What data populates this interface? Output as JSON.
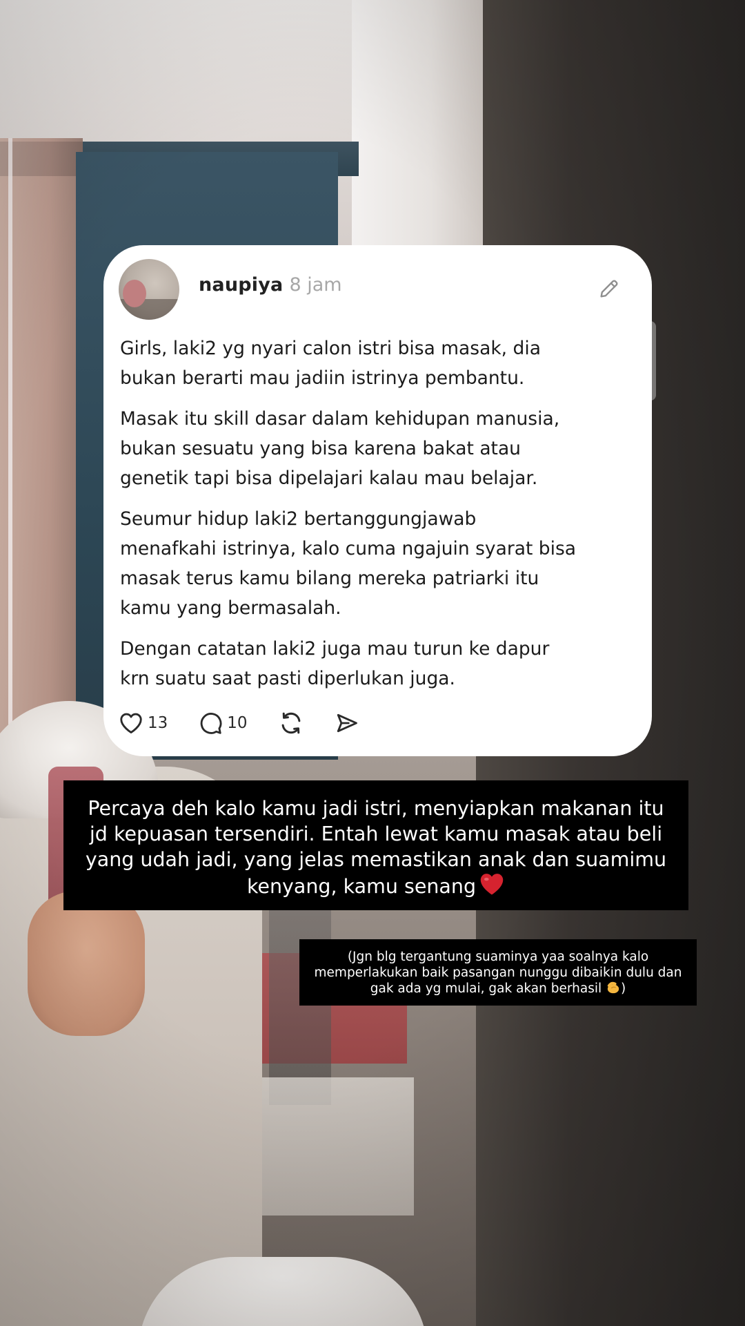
{
  "post": {
    "username": "naupiya",
    "time": "8 jam",
    "paragraphs": [
      "Girls, laki2 yg nyari calon istri bisa masak, dia\nbukan berarti mau jadiin istrinya pembantu.",
      "Masak itu skill dasar dalam kehidupan manusia,\nbukan sesuatu yang bisa karena bakat atau\ngenetik tapi bisa dipelajari kalau mau belajar.",
      "Seumur hidup laki2 bertanggungjawab\nmenafkahi istrinya, kalo cuma ngajuin syarat bisa\nmasak terus kamu bilang mereka patriarki itu\nkamu yang bermasalah.",
      "Dengan catatan laki2 juga mau turun ke dapur\nkrn suatu saat pasti diperlukan juga."
    ],
    "actions": {
      "likes": "13",
      "replies": "10"
    },
    "icons": {
      "edit": "pencil-icon",
      "like": "heart-icon",
      "reply": "comment-icon",
      "repost": "repost-icon",
      "share": "send-icon"
    }
  },
  "caption": {
    "main": "Percaya deh kalo kamu jadi istri, menyiapkan makanan itu\njd kepuasan tersendiri. Entah lewat kamu masak atau beli\nyang udah jadi, yang jelas memastikan anak dan suamimu\nkenyang, kamu senang",
    "main_emoji": "red-heart-emoji",
    "note_text": "(Jgn blg tergantung suaminya yaa soalnya kalo\nmemperlakukan baik pasangan nunggu dibaikin dulu dan\ngak ada yg mulai, gak akan berhasil",
    "note_emoji": "pinching-hand-emoji",
    "note_close": ")"
  },
  "colors": {
    "card_bg": "#ffffff",
    "text_primary": "#1b1b1b",
    "text_muted": "#a7a7a7",
    "caption_bg": "#000000",
    "caption_text": "#ffffff",
    "heart_emoji": "#d6232f"
  }
}
